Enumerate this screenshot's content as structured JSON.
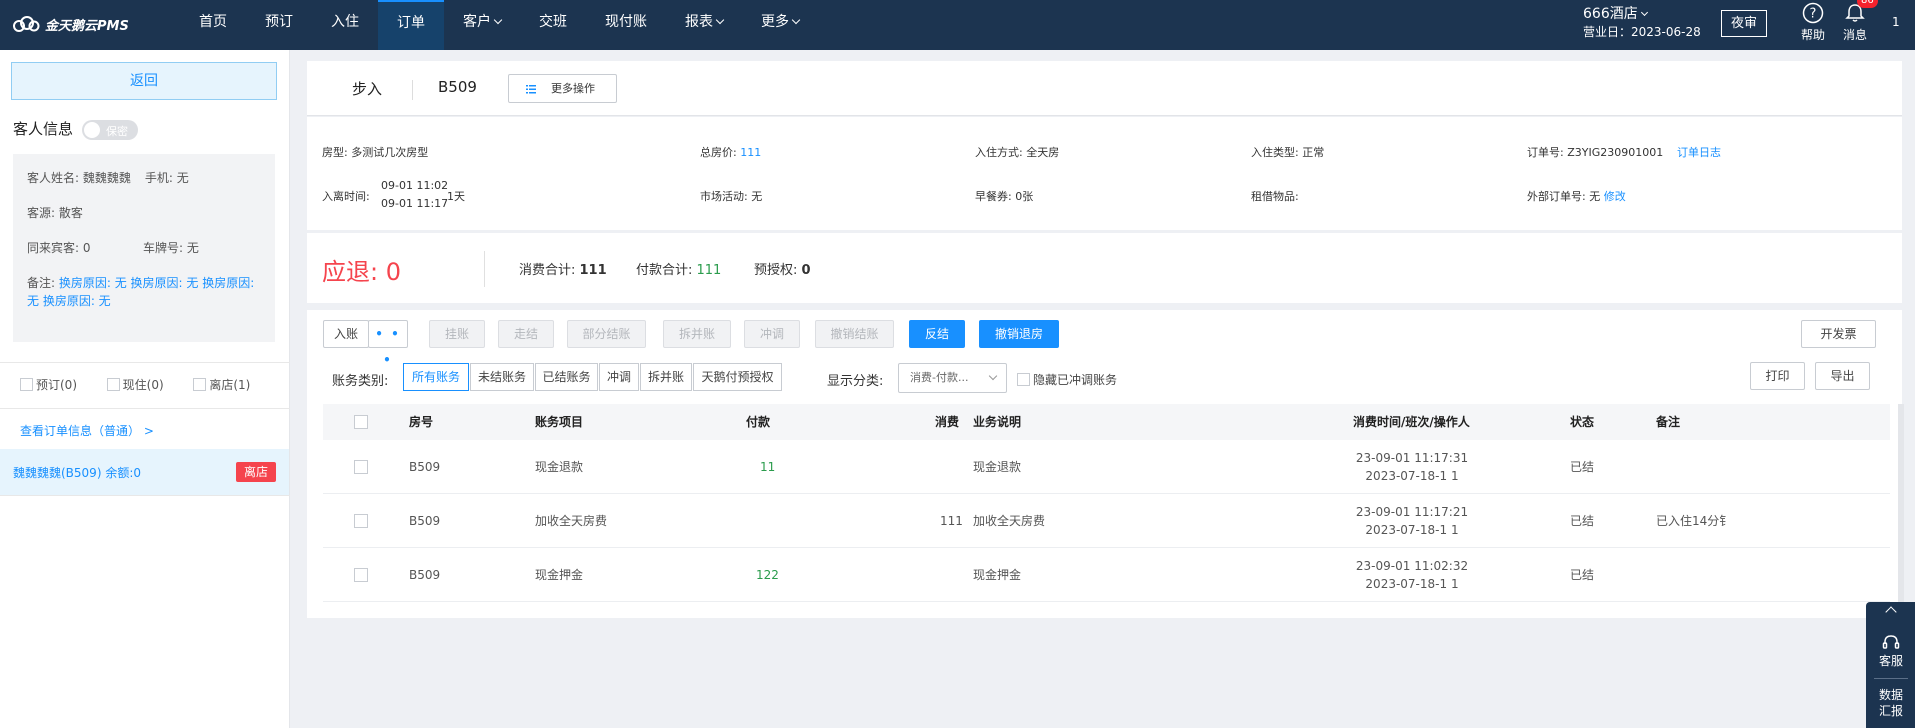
{
  "app": {
    "logo_text": "金天鹅云PMS"
  },
  "nav": {
    "items": [
      {
        "label": "首页",
        "dropdown": false,
        "active": false
      },
      {
        "label": "预订",
        "dropdown": false,
        "active": false
      },
      {
        "label": "入住",
        "dropdown": false,
        "active": false
      },
      {
        "label": "订单",
        "dropdown": false,
        "active": true
      },
      {
        "label": "客户",
        "dropdown": true,
        "active": false
      },
      {
        "label": "交班",
        "dropdown": false,
        "active": false
      },
      {
        "label": "现付账",
        "dropdown": false,
        "active": false
      },
      {
        "label": "报表",
        "dropdown": true,
        "active": false
      },
      {
        "label": "更多",
        "dropdown": true,
        "active": false
      }
    ],
    "hotel_name": "666酒店",
    "business_date": "营业日：2023-06-28",
    "night_audit": "夜审",
    "help": "帮助",
    "messages": "消息",
    "message_count": "86",
    "user_num": "1"
  },
  "left": {
    "back": "返回",
    "guest_info_title": "客人信息",
    "secret_toggle": "保密",
    "guest_name": "客人姓名: 魏魏魏魏",
    "phone": "手机: 无",
    "source": "客源: 散客",
    "companions": "同来宾客: 0",
    "plate": "车牌号: 无",
    "note_label": "备注: ",
    "note_value": "换房原因: 无 换房原因: 无 换房原因: 无 换房原因: 无",
    "status_reserved": "预订(0)",
    "status_inhouse": "现住(0)",
    "status_left": "离店(1)",
    "view_order": "查看订单信息（普通） >",
    "guest_entry": "魏魏魏魏(B509)   余额:0",
    "guest_tag": "离店"
  },
  "header": {
    "tab_walkin": "步入",
    "room_no": "B509",
    "more_ops": "更多操作"
  },
  "info": {
    "room_type": "房型: 多测试几次房型",
    "total_price_label": "总房价: ",
    "total_price": "111",
    "checkin_method": "入住方式: 全天房",
    "checkin_type": "入住类型: 正常",
    "order_no": "订单号: Z3YIG230901001",
    "order_log": "订单日志",
    "stay_time_label": "入离时间:",
    "stay_in": "09-01 11:02",
    "stay_out": "09-01 11:17",
    "stay_days": "1天",
    "market": "市场活动: 无",
    "breakfast": "早餐券: 0张",
    "rental": "租借物品:",
    "ext_order_label": "外部订单号: 无 ",
    "ext_order_edit": "修改"
  },
  "summary": {
    "refund_label": "应退: ",
    "refund_value": "0",
    "consume_label": "消费合计: ",
    "consume_value": "111",
    "payment_label": "付款合计: ",
    "payment_value": "111",
    "preauth_label": "预授权: ",
    "preauth_value": "0"
  },
  "toolbar": {
    "post": "入账",
    "more": "• • •",
    "hang": "挂账",
    "settle": "走结",
    "partial_settle": "部分结账",
    "split_merge": "拆并账",
    "reverse": "冲调",
    "cancel_settle": "撤销结账",
    "unsettle": "反结",
    "cancel_checkout": "撤销退房",
    "invoice": "开发票",
    "print": "打印",
    "export": "导出"
  },
  "filters": {
    "category_label": "账务类别:",
    "categories": [
      "所有账务",
      "未结账务",
      "已结账务",
      "冲调",
      "拆并账",
      "天鹅付预授权"
    ],
    "display_label": "显示分类:",
    "display_value": "消费-付款...",
    "hide_reversed": "隐藏已冲调账务"
  },
  "table": {
    "headers": {
      "room": "房号",
      "item": "账务项目",
      "payment": "付款",
      "consume": "消费",
      "desc": "业务说明",
      "time": "消费时间/班次/操作人",
      "status": "状态",
      "note": "备注"
    },
    "rows": [
      {
        "room": "B509",
        "item": "现金退款",
        "payment": "11",
        "consume": "",
        "desc": "现金退款",
        "time1": "23-09-01 11:17:31",
        "time2": "2023-07-18-1 1",
        "status": "已结",
        "note": ""
      },
      {
        "room": "B509",
        "item": "加收全天房费",
        "payment": "",
        "consume": "111",
        "desc": "加收全天房费",
        "time1": "23-09-01 11:17:21",
        "time2": "2023-07-18-1 1",
        "status": "已结",
        "note": "已入住14分钅"
      },
      {
        "room": "B509",
        "item": "现金押金",
        "payment": "122",
        "consume": "",
        "desc": "现金押金",
        "time1": "23-09-01 11:02:32",
        "time2": "2023-07-18-1 1",
        "status": "已结",
        "note": ""
      }
    ]
  },
  "float": {
    "service": "客服",
    "data_report": "数据汇报"
  },
  "colors": {
    "topbar": "#1c3450",
    "accent": "#1890ff",
    "danger": "#f5444d",
    "success": "#2b9c4d"
  }
}
